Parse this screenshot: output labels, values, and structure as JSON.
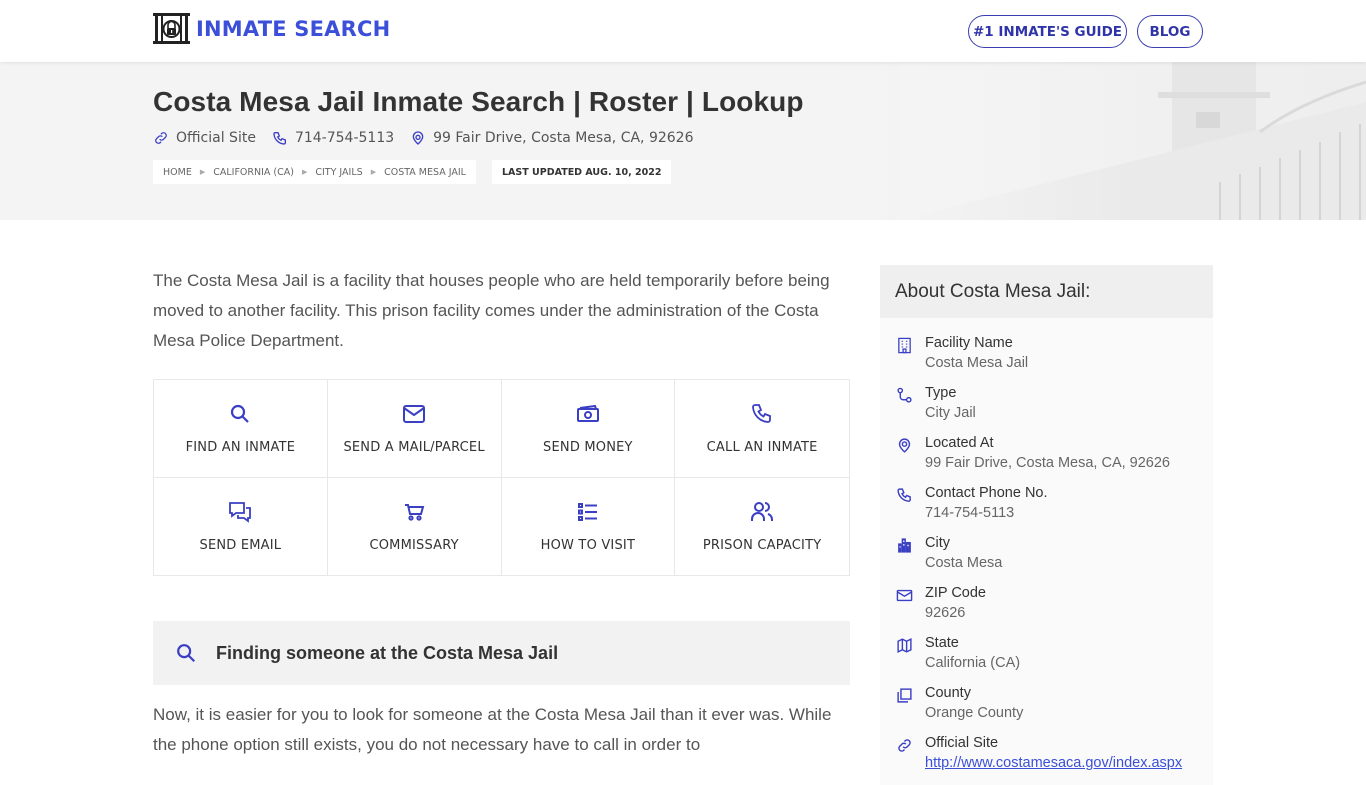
{
  "header": {
    "logo_text": "INMATE SEARCH",
    "nav": [
      {
        "label": "#1 INMATE'S GUIDE"
      },
      {
        "label": "BLOG"
      }
    ]
  },
  "hero": {
    "title": "Costa Mesa Jail Inmate Search | Roster | Lookup",
    "official_site_label": "Official Site",
    "phone": "714-754-5113",
    "address": "99 Fair Drive, Costa Mesa, CA, 92626",
    "breadcrumbs": [
      "HOME",
      "CALIFORNIA (CA)",
      "CITY JAILS",
      "COSTA MESA JAIL"
    ],
    "last_updated": "LAST UPDATED AUG. 10, 2022"
  },
  "intro": "The Costa Mesa Jail is a facility that houses people who are held temporarily before being moved to another facility. This prison facility comes under the administration of the Costa Mesa Police Department.",
  "tiles": [
    {
      "label": "FIND AN INMATE",
      "icon": "search-icon"
    },
    {
      "label": "SEND A MAIL/PARCEL",
      "icon": "mail-icon"
    },
    {
      "label": "SEND MONEY",
      "icon": "money-icon"
    },
    {
      "label": "CALL AN INMATE",
      "icon": "phone-icon"
    },
    {
      "label": "SEND EMAIL",
      "icon": "chat-icon"
    },
    {
      "label": "COMMISSARY",
      "icon": "cart-icon"
    },
    {
      "label": "HOW TO VISIT",
      "icon": "list-icon"
    },
    {
      "label": "PRISON CAPACITY",
      "icon": "users-icon"
    }
  ],
  "section": {
    "title": "Finding someone at the Costa Mesa Jail",
    "body": "Now, it is easier for you to look for someone at the Costa Mesa Jail than it ever was. While the phone option still exists, you do not necessary have to call in order to"
  },
  "about": {
    "title": "About Costa Mesa Jail:",
    "rows": [
      {
        "label": "Facility Name",
        "value": "Costa Mesa Jail",
        "icon": "building-icon"
      },
      {
        "label": "Type",
        "value": "City Jail",
        "icon": "route-icon"
      },
      {
        "label": "Located At",
        "value": "99 Fair Drive, Costa Mesa, CA, 92626",
        "icon": "location-pin-icon"
      },
      {
        "label": "Contact Phone No.",
        "value": "714-754-5113",
        "icon": "phone-icon"
      },
      {
        "label": "City",
        "value": "Costa Mesa",
        "icon": "city-icon"
      },
      {
        "label": "ZIP Code",
        "value": "92626",
        "icon": "mail-icon"
      },
      {
        "label": "State",
        "value": "California (CA)",
        "icon": "map-icon"
      },
      {
        "label": "County",
        "value": "Orange County",
        "icon": "copy-icon"
      },
      {
        "label": "Official Site",
        "value": "http://www.costamesaca.gov/index.aspx",
        "icon": "link-icon"
      }
    ]
  },
  "colors": {
    "accent": "#3b4fd8",
    "icon": "#3a3fc4"
  }
}
